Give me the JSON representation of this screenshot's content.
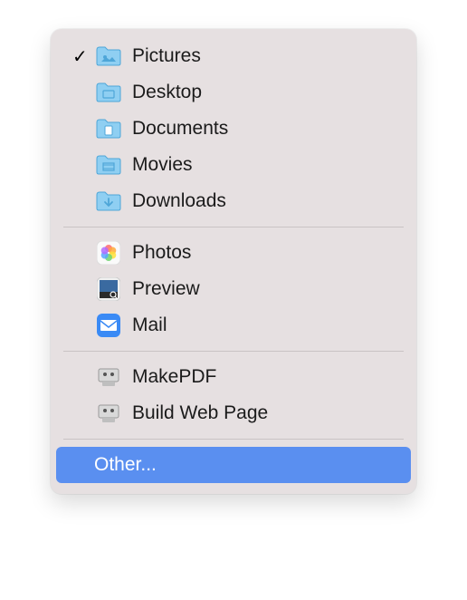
{
  "menu": {
    "groups": [
      {
        "items": [
          {
            "label": "Pictures",
            "icon": "folder-pictures",
            "checked": true
          },
          {
            "label": "Desktop",
            "icon": "folder-desktop",
            "checked": false
          },
          {
            "label": "Documents",
            "icon": "folder-documents",
            "checked": false
          },
          {
            "label": "Movies",
            "icon": "folder-movies",
            "checked": false
          },
          {
            "label": "Downloads",
            "icon": "folder-downloads",
            "checked": false
          }
        ]
      },
      {
        "items": [
          {
            "label": "Photos",
            "icon": "app-photos",
            "checked": false
          },
          {
            "label": "Preview",
            "icon": "app-preview",
            "checked": false
          },
          {
            "label": "Mail",
            "icon": "app-mail",
            "checked": false
          }
        ]
      },
      {
        "items": [
          {
            "label": "MakePDF",
            "icon": "app-automator",
            "checked": false
          },
          {
            "label": "Build Web Page",
            "icon": "app-automator",
            "checked": false
          }
        ]
      },
      {
        "items": [
          {
            "label": "Other...",
            "icon": "",
            "checked": false,
            "highlight": true
          }
        ]
      }
    ]
  }
}
